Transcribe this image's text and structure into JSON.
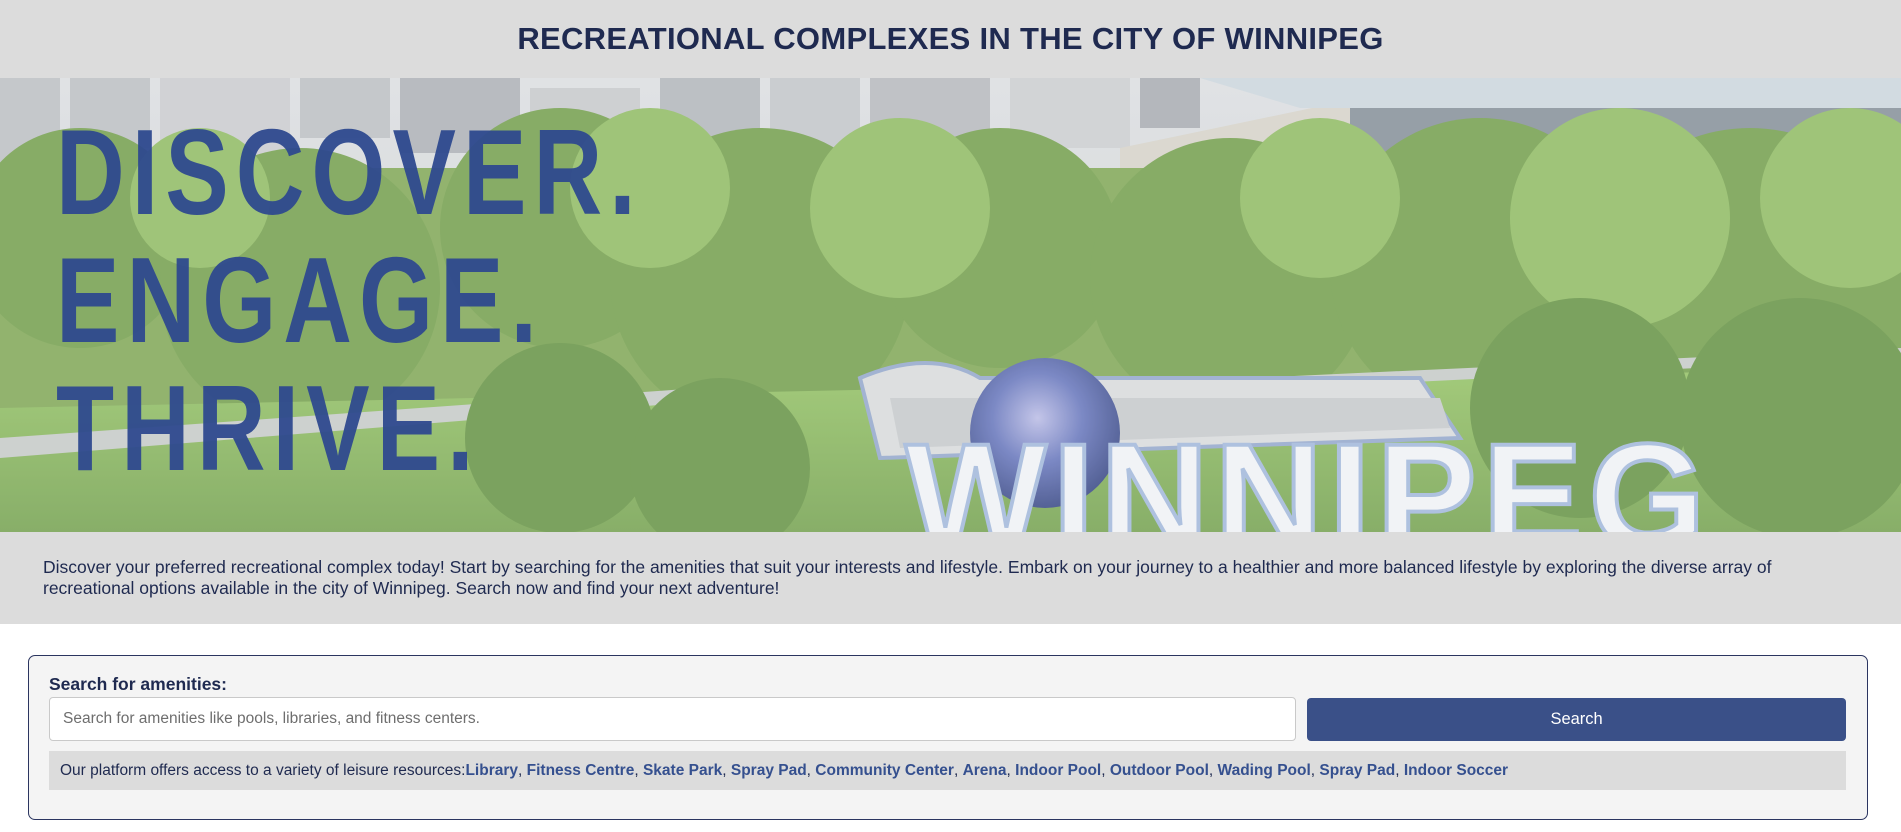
{
  "header": {
    "title": "RECREATIONAL COMPLEXES IN THE CITY OF WINNIPEG"
  },
  "hero": {
    "slogan": [
      "DISCOVER.",
      "ENGAGE.",
      "THRIVE."
    ],
    "sign_text": "WINNIPEG"
  },
  "intro": {
    "text": "Discover your preferred recreational complex today! Start by searching for the amenities that suit your interests and lifestyle. Embark on your journey to a healthier and more balanced lifestyle by exploring the diverse array of recreational options available in the city of Winnipeg. Search now and find your next adventure!"
  },
  "search": {
    "label": "Search for amenities:",
    "placeholder": "Search for amenities like pools, libraries, and fitness centers.",
    "value": "",
    "button_label": "Search"
  },
  "amenities": {
    "intro": "Our platform offers access to a variety of leisure resources: ",
    "items": [
      "Library",
      "Fitness Centre",
      "Skate Park",
      "Spray Pad",
      "Community Center",
      "Arena",
      "Indoor Pool",
      "Outdoor Pool",
      "Wading Pool",
      "Spray Pad",
      "Indoor Soccer"
    ]
  },
  "colors": {
    "header_bg": "#dcdcdc",
    "title_text": "#1f2a50",
    "slogan": "#2f4a8f",
    "button": "#3a5088",
    "link": "#35508f"
  }
}
